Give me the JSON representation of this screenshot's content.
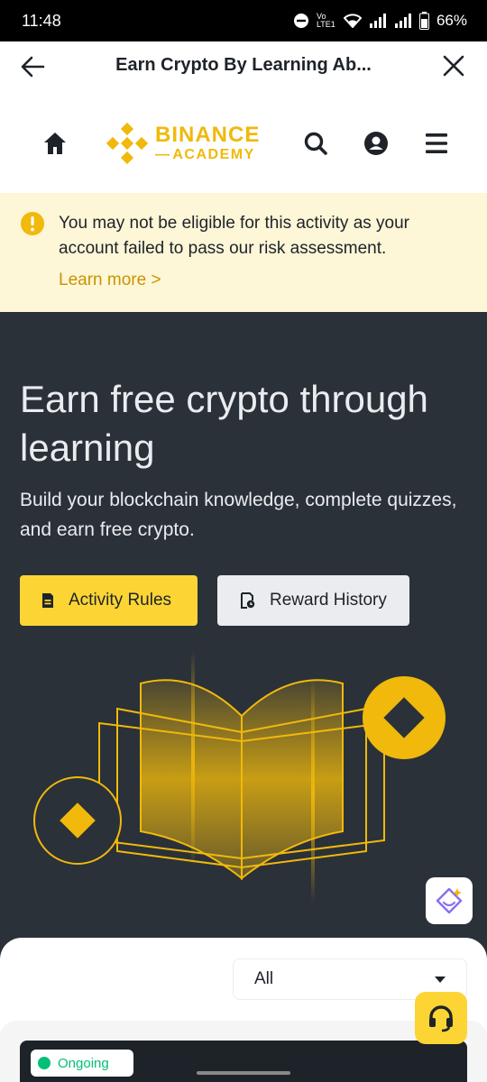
{
  "status_bar": {
    "time": "11:48",
    "network_label": "Vo LTE1",
    "battery": "66%"
  },
  "topnav": {
    "title": "Earn Crypto By Learning Ab..."
  },
  "logo": {
    "line1": "BINANCE",
    "line2": "ACADEMY"
  },
  "warning": {
    "message": "You may not be eligible for this activity as your account failed to pass our risk assessment.",
    "learn_more": "Learn more >"
  },
  "hero": {
    "title": "Earn free crypto through learning",
    "subtitle": "Build your blockchain knowledge, complete quizzes, and earn free crypto.",
    "rules_button": "Activity Rules",
    "history_button": "Reward History"
  },
  "filter": {
    "selected": "All"
  },
  "card": {
    "tag": "Ongoing"
  },
  "colors": {
    "brand": "#f0b90b",
    "button_yellow": "#fcd535",
    "hero_bg": "#2b3139",
    "warning_bg": "#fdf6d7",
    "link": "#c99400"
  }
}
